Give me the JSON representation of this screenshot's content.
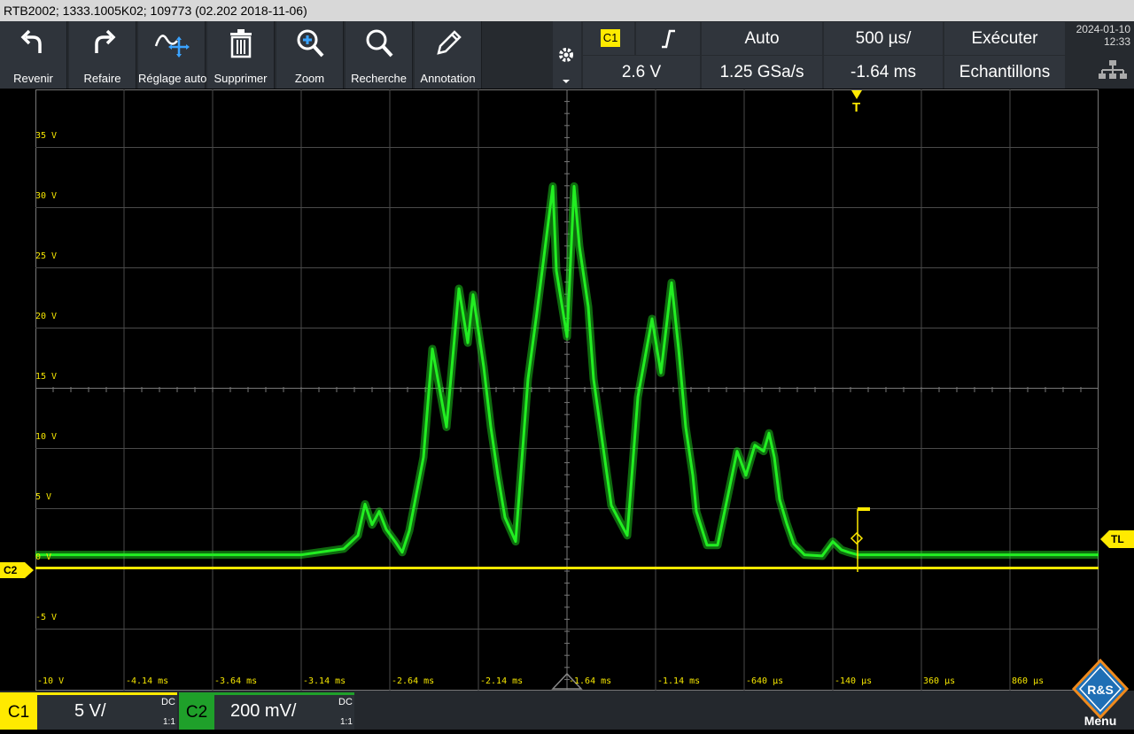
{
  "title": "RTB2002; 1333.1005K02; 109773 (02.202 2018-11-06)",
  "toolbar": {
    "undo": "Revenir",
    "redo": "Refaire",
    "autoset": "Réglage auto",
    "delete": "Supprimer",
    "zoom": "Zoom",
    "search": "Recherche",
    "annotation": "Annotation"
  },
  "trigger": {
    "source": "C1",
    "level": "2.6 V",
    "mode": "Auto",
    "timebase": "500 µs/",
    "sample_rate": "1.25 GSa/s",
    "position": "-1.64 ms",
    "run": "Exécuter",
    "acq": "Echantillons"
  },
  "datetime": {
    "date": "2024-01-10",
    "time": "12:33"
  },
  "markers": {
    "left": "C2",
    "right": "TL",
    "trigger": "T"
  },
  "channels": {
    "c1": {
      "name": "C1",
      "scale": "5 V/",
      "coupling": "DC",
      "ratio": "1:1"
    },
    "c2": {
      "name": "C2",
      "scale": "200 mV/",
      "coupling": "DC",
      "ratio": "1:1"
    }
  },
  "menu_label": "Menu",
  "logo_text": "R&S",
  "colors": {
    "ch1": "#ffea00",
    "ch2": "#22ee22",
    "grid": "#5a5a5a"
  },
  "chart_data": {
    "type": "line",
    "y_tick_labels": [
      "35 V",
      "30 V",
      "25 V",
      "20 V",
      "15 V",
      "10 V",
      "5 V",
      "0 V",
      "-5 V"
    ],
    "y_tick_values": [
      35,
      30,
      25,
      20,
      15,
      10,
      5,
      0,
      -5
    ],
    "x_tick_labels": [
      "-10 V",
      "-4.14 ms",
      "-3.64 ms",
      "-3.14 ms",
      "-2.64 ms",
      "-2.14 ms",
      "-1.64 ms",
      "-1.14 ms",
      "-640 µs",
      "-140 µs",
      "360 µs",
      "860 µs"
    ],
    "ylim": [
      -10,
      37
    ],
    "xlim": [
      -4.64,
      1.36
    ],
    "series": [
      {
        "name": "C1",
        "color": "#22ee22",
        "x": [
          -4.64,
          -3.14,
          -2.9,
          -2.82,
          -2.78,
          -2.74,
          -2.7,
          -2.66,
          -2.61,
          -2.57,
          -2.53,
          -2.45,
          -2.4,
          -2.32,
          -2.25,
          -2.2,
          -2.17,
          -2.11,
          -2.07,
          -2.03,
          -1.99,
          -1.93,
          -1.86,
          -1.81,
          -1.72,
          -1.7,
          -1.64,
          -1.6,
          -1.57,
          -1.52,
          -1.49,
          -1.39,
          -1.3,
          -1.24,
          -1.16,
          -1.11,
          -1.05,
          -1.01,
          -0.97,
          -0.93,
          -0.91,
          -0.85,
          -0.79,
          -0.68,
          -0.63,
          -0.58,
          -0.53,
          -0.5,
          -0.47,
          -0.44,
          -0.4,
          -0.36,
          -0.3,
          -0.2,
          -0.14,
          -0.09,
          -0.05,
          0.0,
          0.1,
          1.36
        ],
        "y": [
          0.4,
          0.4,
          0.9,
          2.0,
          4.6,
          2.9,
          4.0,
          2.5,
          1.5,
          0.6,
          2.4,
          8.5,
          17.5,
          11.0,
          22.5,
          18.0,
          22.0,
          16.0,
          11.0,
          7.0,
          3.5,
          1.5,
          15.0,
          20.5,
          31.0,
          24.0,
          18.5,
          31.0,
          26.0,
          21.0,
          15.0,
          4.5,
          2.0,
          13.5,
          20.0,
          15.5,
          23.0,
          17.5,
          11.0,
          7.0,
          4.0,
          1.2,
          1.2,
          9.0,
          7.0,
          9.5,
          9.0,
          10.5,
          8.5,
          5.0,
          3.0,
          1.3,
          0.4,
          0.3,
          1.5,
          0.8,
          0.6,
          0.4,
          0.4,
          0.4
        ]
      },
      {
        "name": "C2",
        "color": "#ffea00",
        "x": [
          -4.64,
          1.36
        ],
        "y": [
          -0.7,
          -0.7
        ]
      }
    ]
  }
}
